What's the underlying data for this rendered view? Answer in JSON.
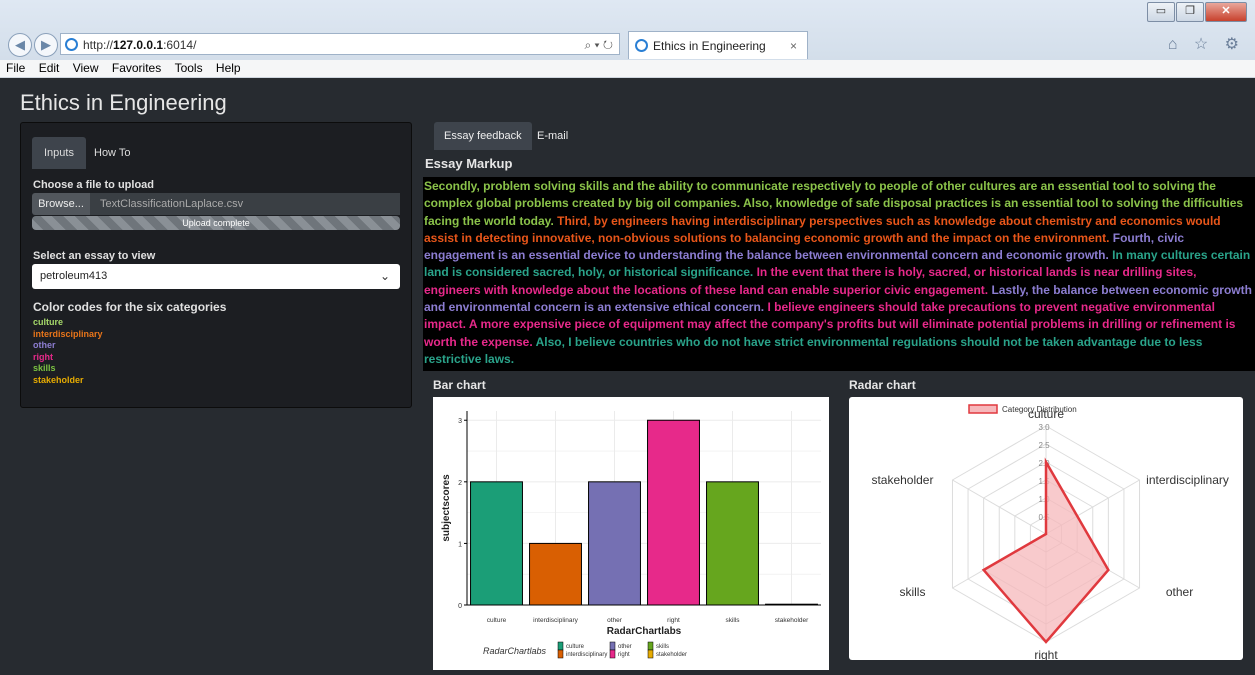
{
  "browser": {
    "url_prefix": "http://",
    "url_host": "127.0.0.1",
    "url_rest": ":6014/",
    "search_controls": "⌕ ▾ ↻",
    "tab_title": "Ethics in Engineering",
    "tab_close": "×",
    "right_icons": "⌂ ☆ ⚙",
    "window_buttons": {
      "minimize": "▭",
      "maximize": "❐",
      "close": "✕"
    },
    "menu": [
      "File",
      "Edit",
      "View",
      "Favorites",
      "Tools",
      "Help"
    ]
  },
  "app": {
    "title": "Ethics in Engineering"
  },
  "sidebar": {
    "tabs": [
      "Inputs",
      "How To"
    ],
    "upload_label": "Choose a file to upload",
    "browse_label": "Browse...",
    "file_name": "TextClassificationLaplace.csv",
    "progress_text": "Upload complete",
    "select_label": "Select an essay to view",
    "selected_essay": "petroleum413",
    "color_header": "Color codes for the six categories",
    "codes": [
      {
        "label": "culture",
        "color": "#a6d96a"
      },
      {
        "label": "interdisciplinary",
        "color": "#e8751a"
      },
      {
        "label": "other",
        "color": "#8c7dd1"
      },
      {
        "label": "right",
        "color": "#e7298a"
      },
      {
        "label": "skills",
        "color": "#7cc242"
      },
      {
        "label": "stakeholder",
        "color": "#e6ab02"
      }
    ]
  },
  "main": {
    "tabs": [
      "Essay feedback",
      "E-mail"
    ],
    "markup_title": "Essay Markup",
    "essay_segments": [
      {
        "text": "Secondly, problem solving skills and the ability to communicate respectively to people of other cultures are an essential tool to solving the complex global problems created by big oil companies. Also, knowledge of safe disposal practices is an essential tool to solving the difficulties facing the world today. ",
        "color": "#8bc34a"
      },
      {
        "text": "Third, by engineers having interdisciplinary perspectives such as knowledge about chemistry and economics would assist in detecting innovative, non-obvious solutions to balancing economic growth and the impact on the environment. ",
        "color": "#e8561a"
      },
      {
        "text": "Fourth, civic engagement is an essential device to understanding the balance between environmental concern and economic growth. ",
        "color": "#8c7dd1"
      },
      {
        "text": "In many cultures certain land is considered sacred, holy, or historical significance. ",
        "color": "#2aa38a"
      },
      {
        "text": "In the event that there is holy, sacred, or historical lands is near drilling sites, engineers with knowledge about the locations of these land can enable superior civic engagement. ",
        "color": "#e7298a"
      },
      {
        "text": "Lastly, the balance between economic growth and environmental concern is an extensive ethical concern. ",
        "color": "#8c7dd1"
      },
      {
        "text": "I believe engineers should take precautions to prevent negative environmental impact. A more expensive piece of equipment may affect the company's profits but will eliminate potential problems in drilling or refinement is worth the expense. ",
        "color": "#e7298a"
      },
      {
        "text": "Also, I believe countries who do not have strict environmental regulations should not be taken advantage due to less restrictive laws.",
        "color": "#2aa38a"
      }
    ],
    "bar_title": "Bar chart",
    "radar_title": "Radar chart"
  },
  "chart_data": [
    {
      "type": "bar",
      "categories": [
        "culture",
        "interdisciplinary",
        "other",
        "right",
        "skills",
        "stakeholder"
      ],
      "values": [
        2,
        1,
        2,
        3,
        2,
        0
      ],
      "colors": [
        "#1b9e77",
        "#d95f02",
        "#7570b3",
        "#e7298a",
        "#66a61e",
        "#e6ab02"
      ],
      "xlabel": "RadarChartlabs",
      "ylabel": "subjectscores",
      "yticks": [
        "0",
        "1",
        "2",
        "3"
      ],
      "ylim": [
        0,
        3.15
      ],
      "legend_title": "RadarChartlabs",
      "legend_position": "bottom",
      "grid": true
    },
    {
      "type": "radar",
      "axes": [
        "culture",
        "interdisciplinary",
        "other",
        "right",
        "skills",
        "stakeholder"
      ],
      "values": [
        2,
        1,
        2,
        3,
        2,
        0
      ],
      "rings": [
        "0.5",
        "1.0",
        "1.5",
        "2.0",
        "2.5",
        "3.0"
      ],
      "max": 3,
      "series_name": "Category Distribution",
      "line_color": "#e0393e",
      "fill_color": "#f6b8bb",
      "legend_position": "top"
    }
  ]
}
